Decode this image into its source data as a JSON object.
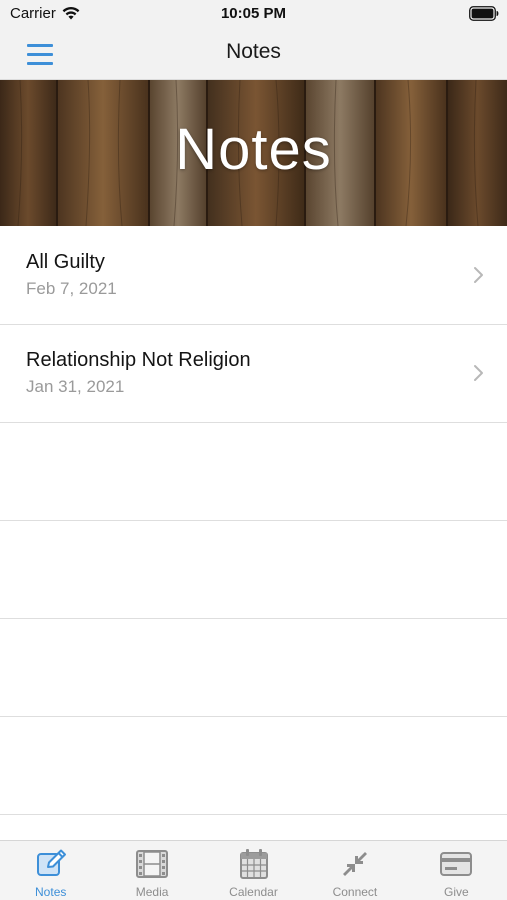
{
  "status_bar": {
    "carrier": "Carrier",
    "time": "10:05 PM"
  },
  "nav_bar": {
    "title": "Notes",
    "menu_icon": "hamburger-menu-icon"
  },
  "banner": {
    "title": "Notes"
  },
  "notes": [
    {
      "title": "All Guilty",
      "date": "Feb 7, 2021"
    },
    {
      "title": "Relationship Not Religion",
      "date": "Jan 31, 2021"
    }
  ],
  "tabs": [
    {
      "label": "Notes",
      "icon": "edit-note-icon",
      "active": true
    },
    {
      "label": "Media",
      "icon": "film-icon",
      "active": false
    },
    {
      "label": "Calendar",
      "icon": "calendar-icon",
      "active": false
    },
    {
      "label": "Connect",
      "icon": "connect-arrows-icon",
      "active": false
    },
    {
      "label": "Give",
      "icon": "credit-card-icon",
      "active": false
    }
  ],
  "colors": {
    "accent": "#3d8fd8",
    "inactive_tab": "#8d8d8d",
    "nav_background": "#f2f2f2"
  }
}
